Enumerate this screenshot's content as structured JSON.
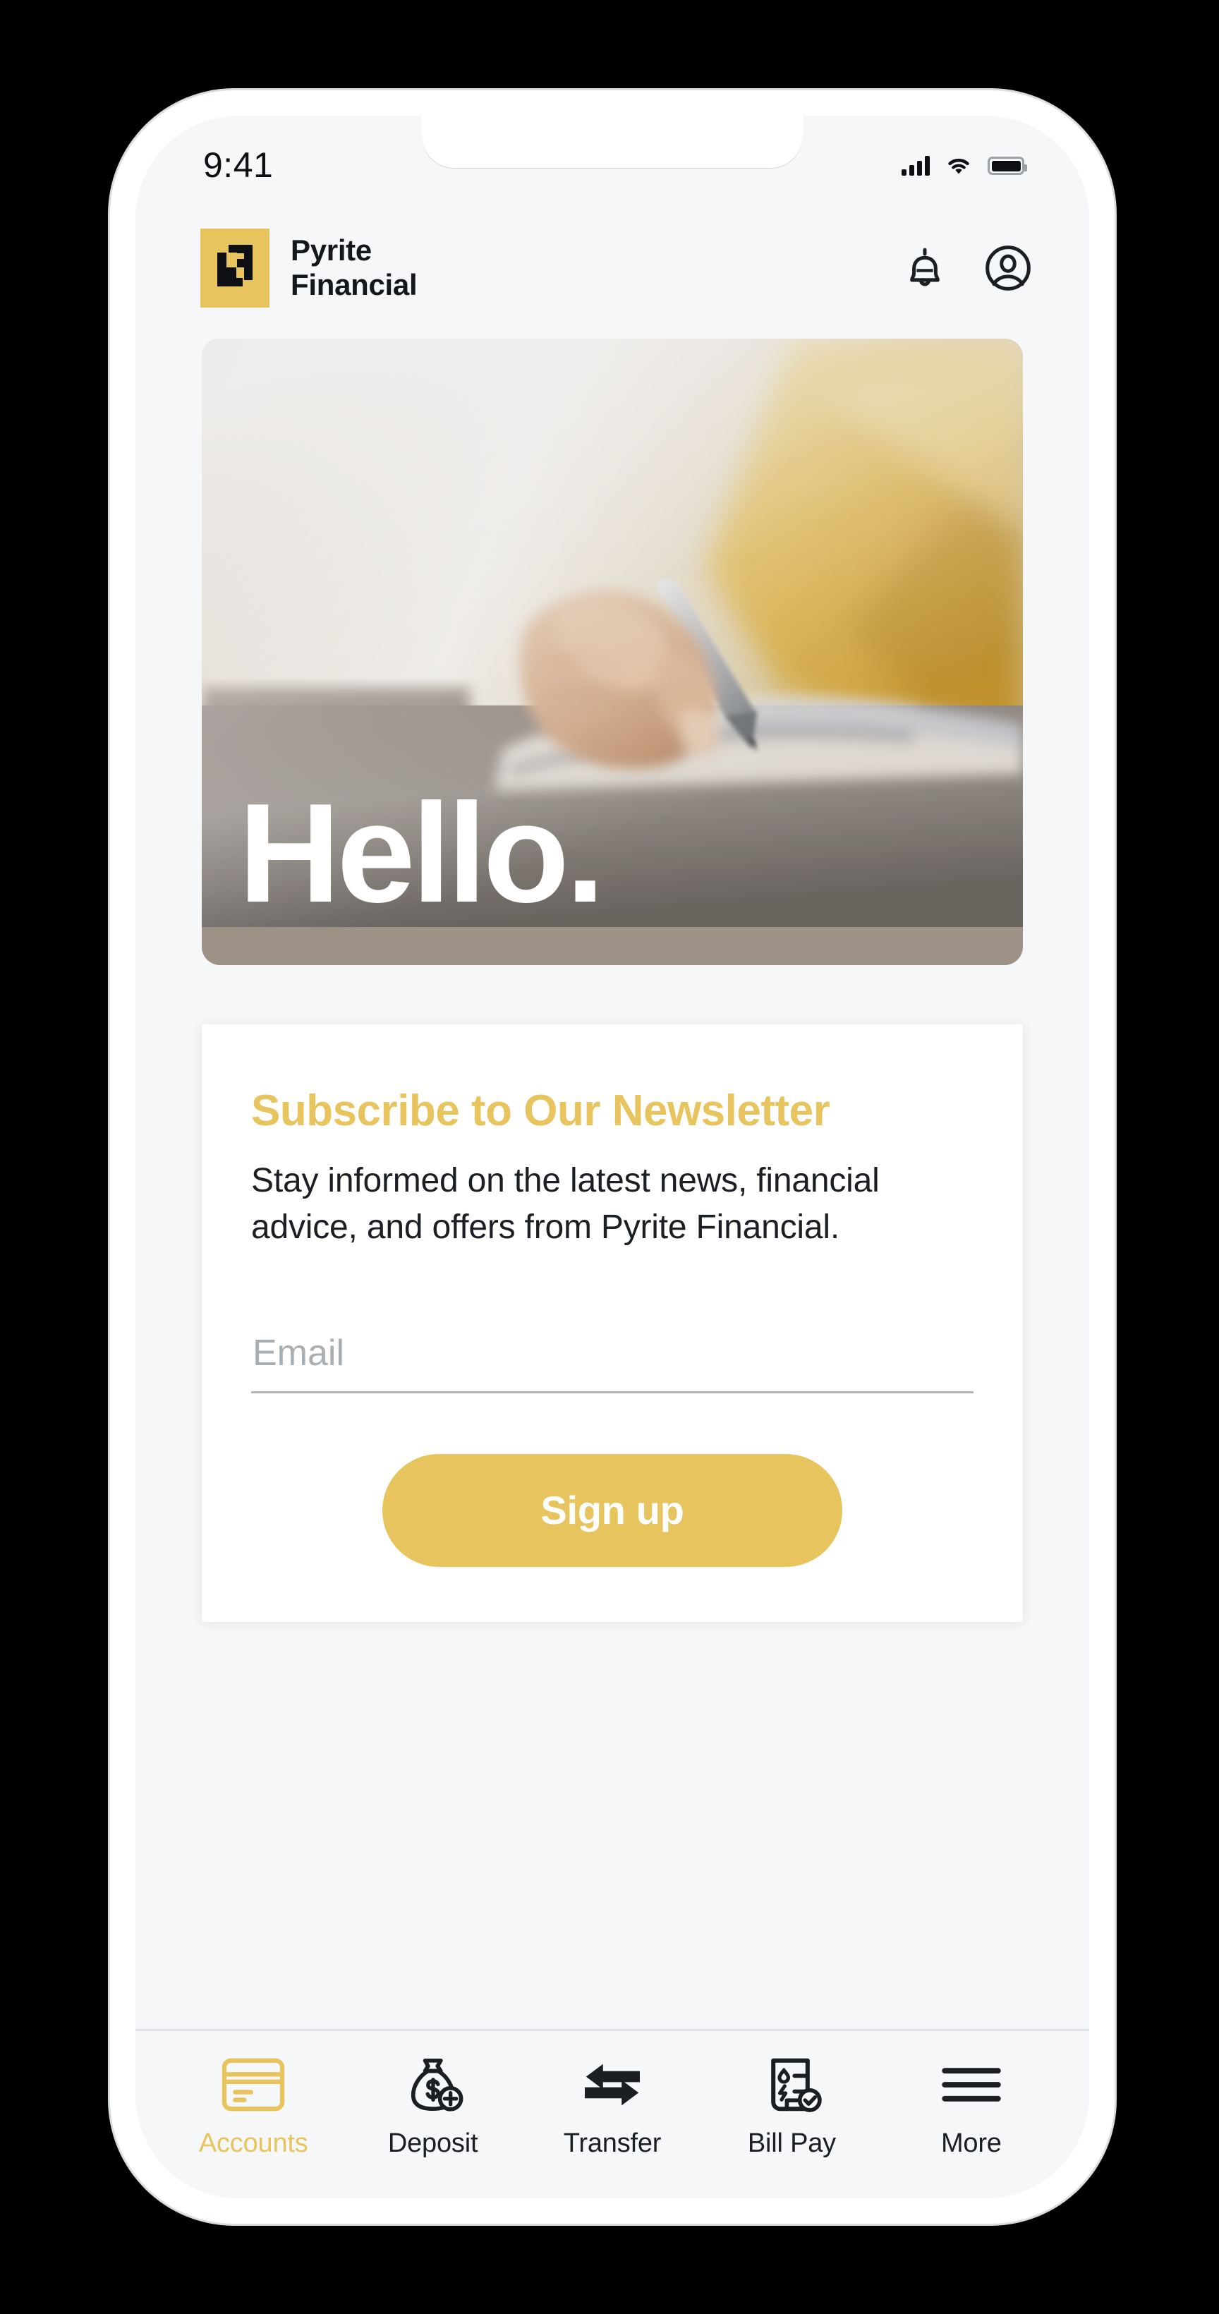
{
  "status_bar": {
    "time": "9:41",
    "cellular_icon": "signal-bars-icon",
    "wifi_icon": "wifi-icon",
    "battery_icon": "battery-full-icon"
  },
  "header": {
    "logo_icon": "pyrite-logo-icon",
    "brand_line1": "Pyrite",
    "brand_line2": "Financial",
    "notification_icon": "bell-icon",
    "account_icon": "account-circle-icon"
  },
  "hero": {
    "title": "Hello.",
    "image_alt": "hand-writing-in-notebook-photo"
  },
  "newsletter": {
    "title": "Subscribe to Our Newsletter",
    "description": "Stay informed on the latest news, financial advice, and offers from Pyrite Financial.",
    "email_placeholder": "Email",
    "email_value": "",
    "signup_label": "Sign up"
  },
  "bottom_nav": {
    "items": [
      {
        "label": "Accounts",
        "icon": "credit-card-icon",
        "active": true
      },
      {
        "label": "Deposit",
        "icon": "money-bag-plus-icon",
        "active": false
      },
      {
        "label": "Transfer",
        "icon": "transfer-arrows-icon",
        "active": false
      },
      {
        "label": "Bill Pay",
        "icon": "invoice-check-icon",
        "active": false
      },
      {
        "label": "More",
        "icon": "hamburger-menu-icon",
        "active": false
      }
    ]
  },
  "colors": {
    "brand_gold": "#e8c45f",
    "ink": "#1b1f24",
    "screen_bg": "#f6f7f8",
    "card_bg": "#ffffff",
    "divider": "#dfe3e7"
  }
}
